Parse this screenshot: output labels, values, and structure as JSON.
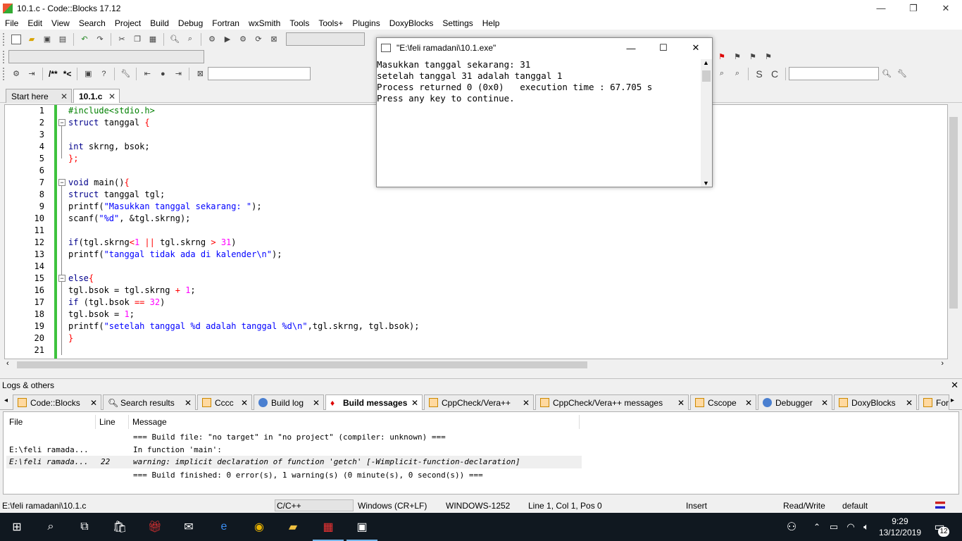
{
  "window": {
    "title": "10.1.c - Code::Blocks 17.12"
  },
  "menu": [
    "File",
    "Edit",
    "View",
    "Search",
    "Project",
    "Build",
    "Debug",
    "Fortran",
    "wxSmith",
    "Tools",
    "Tools+",
    "Plugins",
    "DoxyBlocks",
    "Settings",
    "Help"
  ],
  "toolbar": {
    "comment_label": "/**",
    "uncomment_label": "*<"
  },
  "tabs": [
    {
      "label": "Start here",
      "active": false
    },
    {
      "label": "10.1.c",
      "active": true
    }
  ],
  "editor": {
    "line_numbers": [
      "1",
      "2",
      "3",
      "4",
      "5",
      "6",
      "7",
      "8",
      "9",
      "10",
      "11",
      "12",
      "13",
      "14",
      "15",
      "16",
      "17",
      "18",
      "19",
      "20",
      "21"
    ]
  },
  "console": {
    "title": "\"E:\\feli ramadani\\10.1.exe\"",
    "lines": [
      "Masukkan tanggal sekarang: 31",
      "setelah tanggal 31 adalah tanggal 1",
      "",
      "Process returned 0 (0x0)   execution time : 67.705 s",
      "Press any key to continue."
    ]
  },
  "logs": {
    "header": "Logs & others",
    "tabs": [
      "Code::Blocks",
      "Search results",
      "Cccc",
      "Build log",
      "Build messages",
      "CppCheck/Vera++",
      "CppCheck/Vera++ messages",
      "Cscope",
      "Debugger",
      "DoxyBlocks",
      "Fort"
    ],
    "active_tab": "Build messages",
    "columns": {
      "file": "File",
      "line": "Line",
      "message": "Message"
    },
    "rows": [
      {
        "file": "",
        "line": "",
        "message": "=== Build file: \"no target\" in \"no project\" (compiler: unknown) ==="
      },
      {
        "file": "E:\\feli ramada...",
        "line": "",
        "message": "In function 'main':"
      },
      {
        "file": "E:\\feli ramada...",
        "line": "22",
        "message": "warning: implicit declaration of function 'getch' [-Wimplicit-function-declaration]"
      },
      {
        "file": "",
        "line": "",
        "message": "=== Build finished: 0 error(s), 1 warning(s) (0 minute(s), 0 second(s)) ==="
      }
    ]
  },
  "status": {
    "path": "E:\\feli ramadani\\10.1.c",
    "language": "C/C++",
    "eol": "Windows (CR+LF)",
    "encoding": "WINDOWS-1252",
    "position": "Line 1, Col 1, Pos 0",
    "mode": "Insert",
    "access": "Read/Write",
    "profile": "default"
  },
  "taskbar": {
    "time": "9:29",
    "date": "13/12/2019",
    "notifications": "12"
  },
  "colors": {
    "gutter_change": "#3ec23e",
    "keyword": "#00008b",
    "preprocessor": "#008000",
    "string": "#0000ff",
    "number": "#ff00ff",
    "taskbar": "#101820"
  }
}
